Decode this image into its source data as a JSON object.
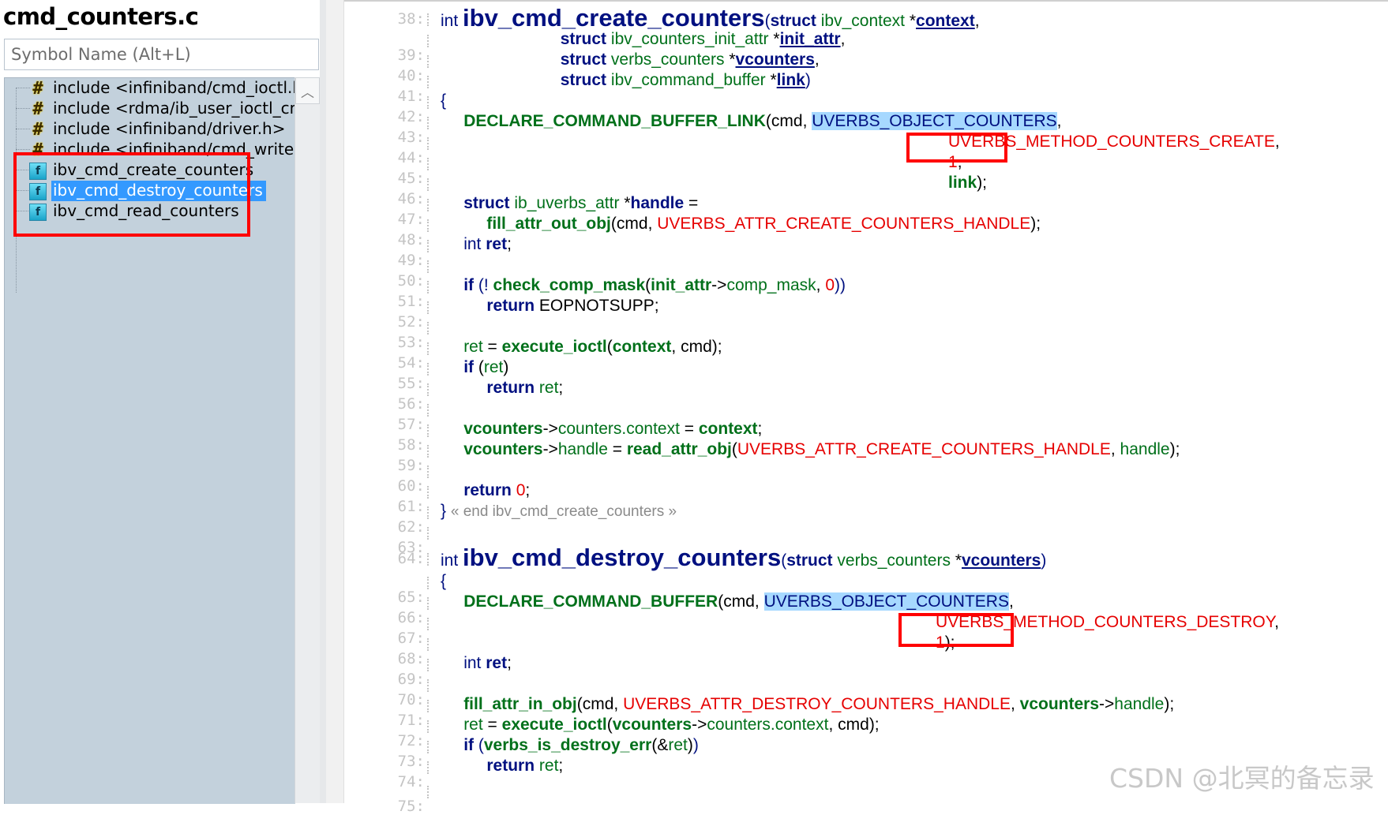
{
  "file_title": "cmd_counters.c",
  "search": {
    "placeholder": "Symbol Name (Alt+L)",
    "value": ""
  },
  "symbols": [
    {
      "label": "include <infiniband/cmd_ioctl.h>",
      "icon": "include-hash-icon"
    },
    {
      "label": "include <rdma/ib_user_ioctl_cmds.h>",
      "icon": "include-hash-icon"
    },
    {
      "label": "include <infiniband/driver.h>",
      "icon": "include-hash-icon"
    },
    {
      "label": "include <infiniband/cmd_write.h>",
      "icon": "include-hash-icon"
    },
    {
      "label": "ibv_cmd_create_counters",
      "icon": "function-icon"
    },
    {
      "label": "ibv_cmd_destroy_counters",
      "icon": "function-icon",
      "selected": true
    },
    {
      "label": "ibv_cmd_read_counters",
      "icon": "function-icon"
    }
  ],
  "code": {
    "line_numbers": [
      "38:",
      "39:",
      "40:",
      "41:",
      "42:",
      "43:",
      "44:",
      "45:",
      "46:",
      "47:",
      "48:",
      "49:",
      "50:",
      "51:",
      "52:",
      "53:",
      "54:",
      "55:",
      "56:",
      "57:",
      "58:",
      "59:",
      "60:",
      "61:",
      "62:",
      "63:",
      "64:",
      "65:",
      "66:",
      "67:",
      "68:",
      "69:",
      "70:",
      "71:",
      "72:",
      "73:",
      "74:",
      "75:"
    ],
    "tokens": {
      "int": "int",
      "struct": "struct",
      "fn_create": "ibv_cmd_create_counters",
      "fn_destroy": "ibv_cmd_destroy_counters",
      "ibv_context": "ibv_context",
      "context": "context",
      "ibv_counters_init_attr": "ibv_counters_init_attr",
      "init_attr": "init_attr",
      "verbs_counters": "verbs_counters",
      "vcounters": "vcounters",
      "ibv_command_buffer": "ibv_command_buffer",
      "link": "link",
      "declare_link": "DECLARE_COMMAND_BUFFER_LINK",
      "declare": "DECLARE_COMMAND_BUFFER",
      "cmd": "cmd",
      "obj_counters": "UVERBS_OBJECT_COUNTERS",
      "method_counters": "UVERBS_METHOD_COUNTERS",
      "create": "_CREATE",
      "destroy": "_DESTROY",
      "one": "1",
      "zero": "0",
      "ib_uverbs_attr": "ib_uverbs_attr",
      "handle": "handle",
      "fill_out": "fill_attr_out_obj",
      "fill_in": "fill_attr_in_obj",
      "attr_create_handle": "UVERBS_ATTR_CREATE_COUNTERS_HANDLE",
      "attr_destroy_handle": "UVERBS_ATTR_DESTROY_COUNTERS_HANDLE",
      "ret": "ret",
      "if": "if",
      "return": "return",
      "check_comp_mask": "check_comp_mask",
      "comp_mask": "comp_mask",
      "eopnotsupp": "EOPNOTSUPP",
      "execute_ioctl": "execute_ioctl",
      "counters_context": "counters.context",
      "read_attr_obj": "read_attr_obj",
      "verbs_is_destroy_err": "verbs_is_destroy_err",
      "end_comment": "« end ibv_cmd_create_counters »"
    }
  },
  "watermark": "CSDN @北冥的备忘录",
  "colors": {
    "highlight": "#a6d8ff",
    "selection": "#3399ff",
    "annotation_box": "#ff0000",
    "tree_bg": "#c3d1dc"
  }
}
